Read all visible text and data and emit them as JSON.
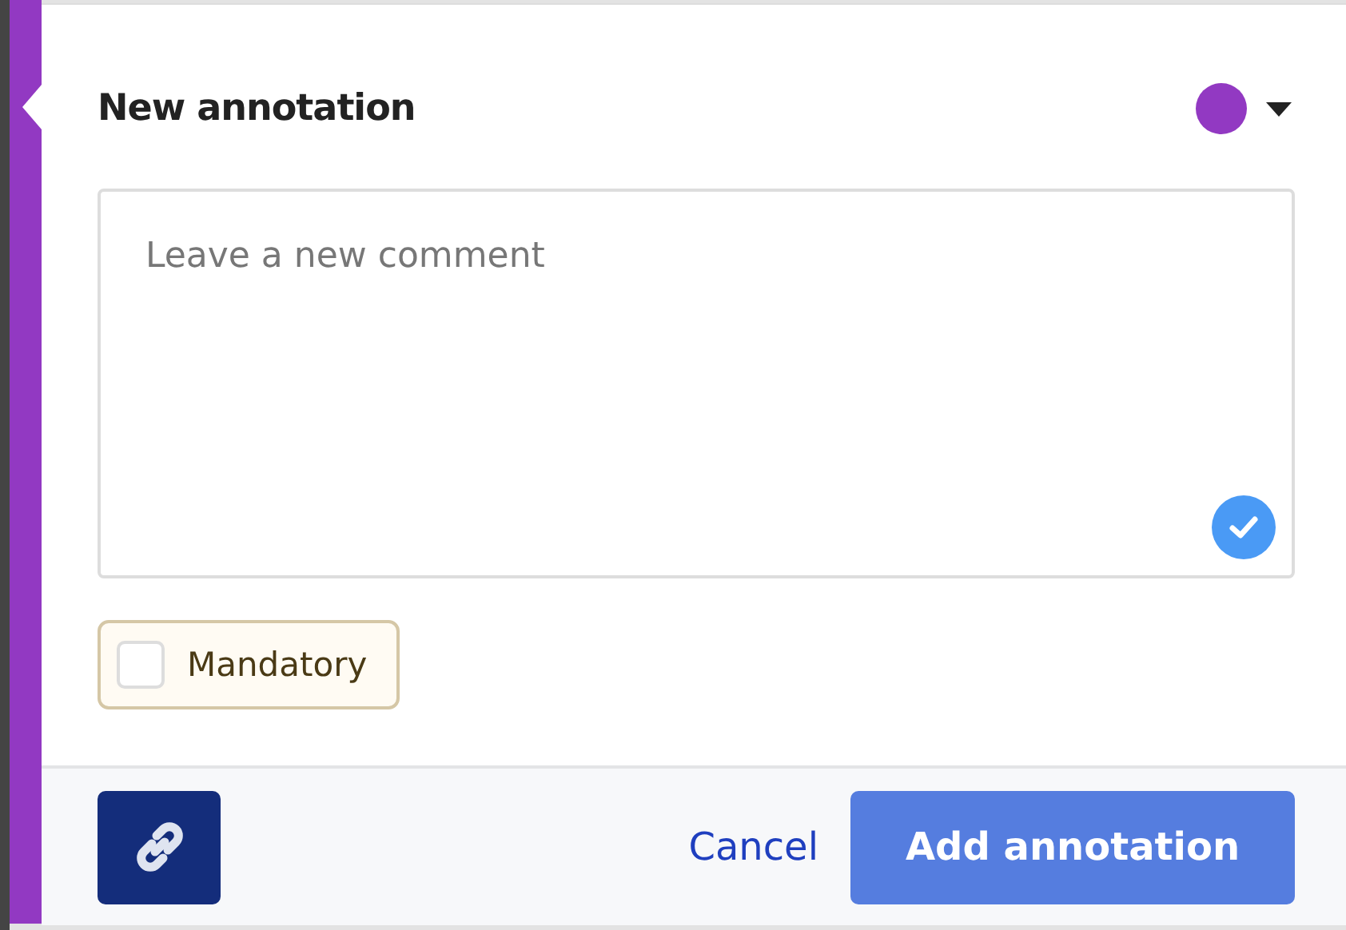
{
  "header": {
    "title": "New annotation",
    "color": "#9239c2"
  },
  "comment": {
    "placeholder": "Leave a new comment"
  },
  "mandatory": {
    "label": "Mandatory",
    "checked": false
  },
  "footer": {
    "cancel": "Cancel",
    "submit": "Add annotation"
  }
}
